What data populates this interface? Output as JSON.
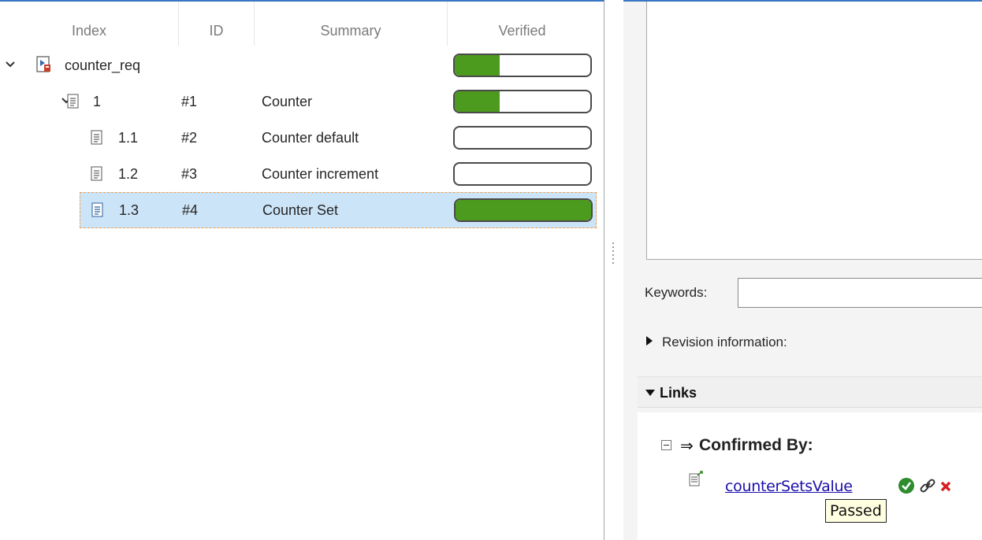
{
  "tree": {
    "columns": {
      "index": "Index",
      "id": "ID",
      "summary": "Summary",
      "verified": "Verified"
    },
    "root": {
      "name": "counter_req",
      "verified_fraction": 0.33
    },
    "rows": [
      {
        "index": "1",
        "id": "#1",
        "summary": "Counter",
        "verified_fraction": 0.33
      },
      {
        "index": "1.1",
        "id": "#2",
        "summary": "Counter default",
        "verified_fraction": 0
      },
      {
        "index": "1.2",
        "id": "#3",
        "summary": "Counter increment",
        "verified_fraction": 0
      },
      {
        "index": "1.3",
        "id": "#4",
        "summary": "Counter Set",
        "verified_fraction": 1.0
      }
    ],
    "selected_row": "1.3"
  },
  "details": {
    "keywords_label": "Keywords:",
    "keywords_value": "",
    "revision_label": "Revision information:",
    "links_label": "Links",
    "confirmed_by_arrow": "⇒",
    "confirmed_by_label": "Confirmed By:",
    "link_name": "counterSetsValue",
    "tooltip": "Passed"
  },
  "colors": {
    "accent": "#3a76c4",
    "verified_fill": "#4c9a1e",
    "selected_row": "#cce4f7",
    "link": "#1a0dab"
  },
  "icons": [
    "chevron-down-icon",
    "requirement-set-icon",
    "requirement-icon",
    "test-case-icon",
    "passed-check-icon",
    "link-chain-icon",
    "delete-x-icon"
  ]
}
